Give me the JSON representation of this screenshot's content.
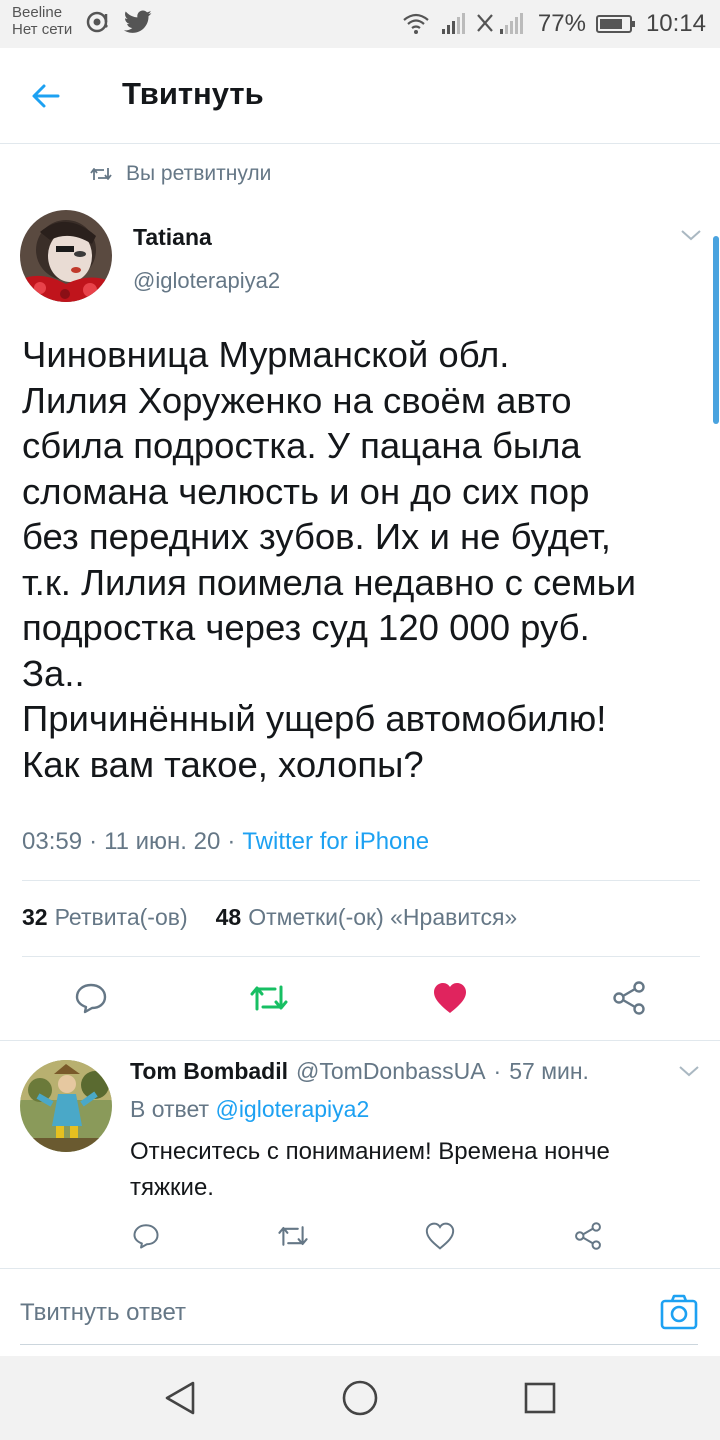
{
  "status_bar": {
    "carrier": "Beeline",
    "no_network": "Нет сети",
    "battery_percent": "77%",
    "time": "10:14"
  },
  "app_bar": {
    "title": "Твитнуть"
  },
  "retweet_context": "Вы ретвитнули",
  "tweet": {
    "author_name": "Tatiana",
    "author_handle": "@igloterapiya2",
    "text": "Чиновница Мурманской обл.\nЛилия Хоруженко на своём авто\nсбила подростка. У пацана была\nсломана челюсть и он до сих пор\nбез передних зубов. Их и не будет,\nт.к. Лилия поимела недавно с семьи\nподростка через суд 120 000 руб.\nЗа..\nПричинённый ущерб автомобилю!\nКак вам такое, холопы?",
    "time": "03:59",
    "sep1": "·",
    "date": "11 июн. 20",
    "sep2": "·",
    "source": "Twitter for iPhone",
    "retweet_count": "32",
    "retweet_label": "Ретвита(-ов)",
    "like_count": "48",
    "like_label": "Отметки(-ок) «Нравится»",
    "liked_color": "#e0245e",
    "retweet_color": "#17bf63"
  },
  "reply": {
    "author_name": "Tom Bombadil",
    "author_handle": "@TomDonbassUA",
    "sep": "·",
    "time_ago": "57 мин.",
    "reply_to_label": "В ответ",
    "reply_to_handle": "@igloterapiya2",
    "text": "Отнеситесь с пониманием! Времена нонче тяжкие."
  },
  "compose": {
    "placeholder": "Твитнуть ответ"
  },
  "colors": {
    "accent": "#1da1f2",
    "secondary_text": "#657786"
  }
}
